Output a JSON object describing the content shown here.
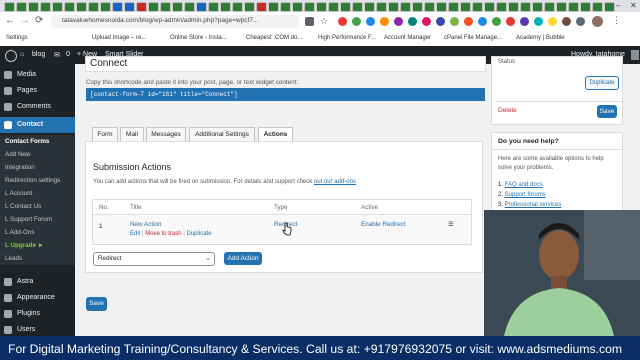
{
  "browser": {
    "url": "tatavaluehomesnoida.com/blog/wp-admin/admin.php?page=wpcf7...",
    "bookmarks": [
      "Settings",
      "Upload Image – re...",
      "Online Store - Insta...",
      "Cheapest .COM do...",
      "High Performance F...",
      "Account Manager",
      "cPanel File Manage...",
      "Academy | Bubble"
    ]
  },
  "adminbar": {
    "site": "blog",
    "comments_count": "0",
    "new_label": "+ New",
    "smart_slider": "Smart Slider",
    "greeting": "Howdy, tatahome"
  },
  "sidebar": {
    "items_top": [
      "Media",
      "Pages",
      "Comments",
      "Contact"
    ],
    "submenu": [
      "Contact Forms",
      "Add New",
      "Integration",
      "Redirection settings",
      "L Account",
      "L Contact Us",
      "L Support Forum",
      "L Add-Ons",
      "L Upgrade ►",
      "Leads"
    ],
    "items_bottom": [
      "Astra",
      "Appearance",
      "Plugins",
      "Users"
    ]
  },
  "form": {
    "title": "Connect",
    "shortcode_hint": "Copy this shortcode and paste it into your post, page, or text widget content:",
    "shortcode": "[contact-form-7 id=\"161\" title=\"Connect\"]",
    "tabs": [
      "Form",
      "Mail",
      "Messages",
      "Additional Settings",
      "Actions"
    ],
    "active_tab": "Actions",
    "section_title": "Submission Actions",
    "section_desc": "You can add actions that will be fired on submission. For details and support check",
    "addons_link": "out our add-ons",
    "table_headers": [
      "No.",
      "Title",
      "Type",
      "Active"
    ],
    "rows": [
      {
        "no": "1",
        "title": "New Action",
        "edit": "Edit",
        "trash": "Move to trash",
        "duplicate": "Duplicate",
        "type": "Redirect",
        "active": "Enable Redirect"
      }
    ],
    "select_value": "Redirect",
    "add_action": "Add Action",
    "save": "Save"
  },
  "status_box": {
    "label": "Status",
    "duplicate": "Duplicate",
    "delete": "Delete",
    "save": "Save"
  },
  "help_box": {
    "title": "Do you need help?",
    "text": "Here are some available options to help solve your problems.",
    "items": [
      "FAQ and docs",
      "Support forums",
      "Professional services"
    ]
  },
  "footer": {
    "text": "For Digital Marketing Training/Consultancy & Services. Call us at: +917976932075 or visit: www.adsmediums.com"
  },
  "colors": {
    "wp_dark": "#1d2327",
    "wp_blue": "#2271b1",
    "footer_bg": "#0a2d66"
  }
}
